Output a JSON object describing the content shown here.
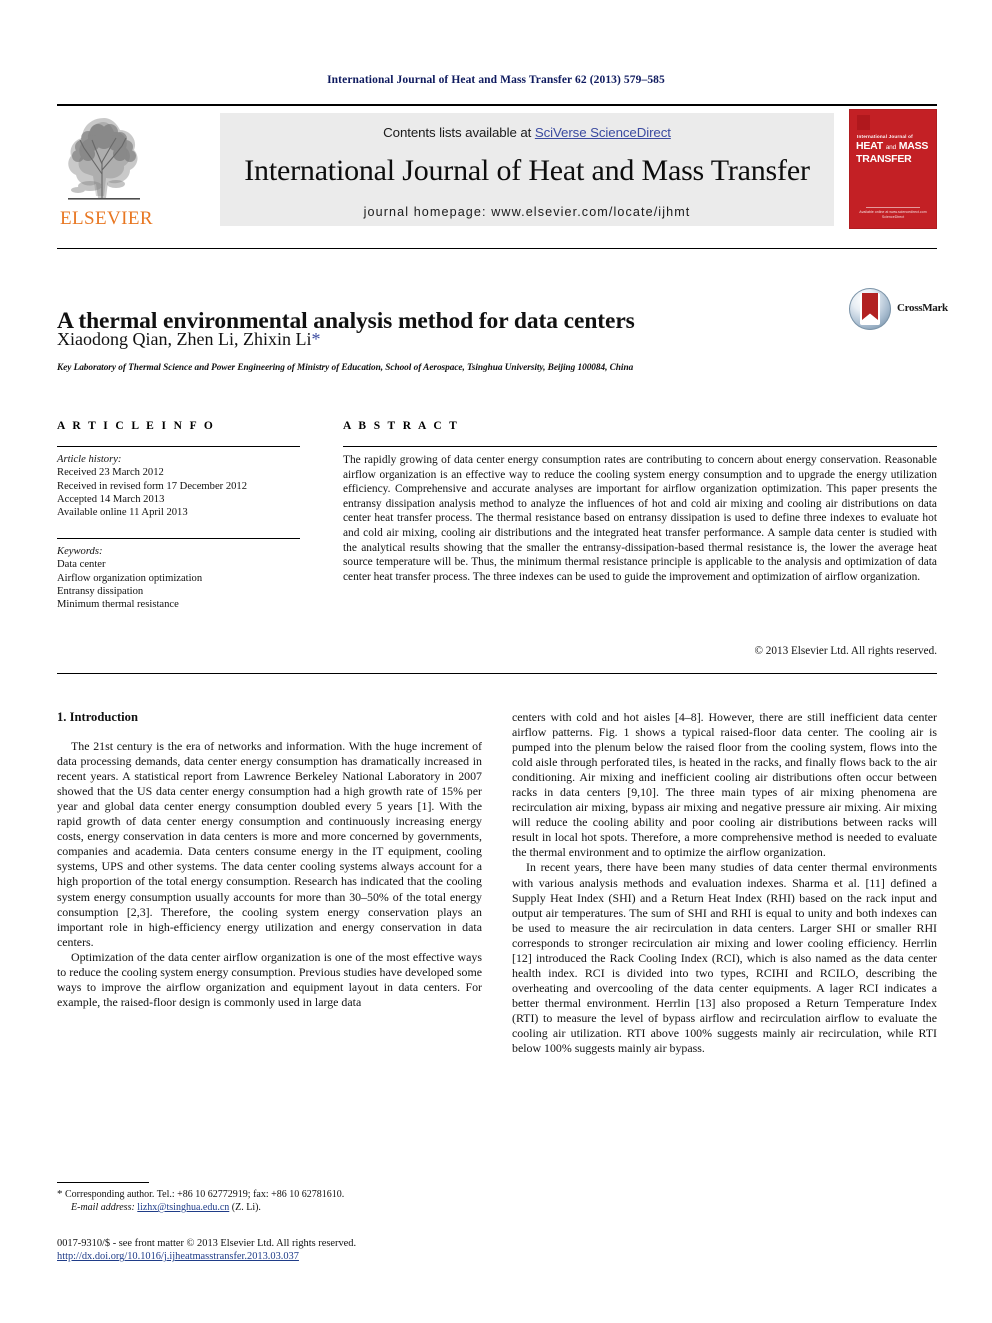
{
  "running_head": "International Journal of Heat and Mass Transfer 62 (2013) 579–585",
  "masthead": {
    "contents_prefix": "Contents lists available at ",
    "sciencedirect_link": "SciVerse ScienceDirect",
    "journal_name": "International Journal of Heat and Mass Transfer",
    "homepage": "journal homepage: www.elsevier.com/locate/ijhmt",
    "publisher": "ELSEVIER",
    "cover": {
      "small_label": "International Journal of",
      "line1": "HEAT",
      "line1_small": "and",
      "line1_b": "MASS",
      "line2": "TRANSFER",
      "footer": "Available online at www.sciencedirect.com",
      "footer2": "ScienceDirect"
    },
    "link_color": "#3b4ba0"
  },
  "article": {
    "title": "A thermal environmental analysis method for data centers",
    "authors": "Xiaodong Qian, Zhen Li, Zhixin Li",
    "author_star": "*",
    "affiliation": "Key Laboratory of Thermal Science and Power Engineering of Ministry of Education, School of Aerospace, Tsinghua University, Beijing 100084, China",
    "crossmark_label": "CrossMark"
  },
  "info": {
    "heading": "A R T I C L E    I N F O",
    "history_label": "Article history:",
    "history": [
      "Received 23 March 2012",
      "Received in revised form 17 December 2012",
      "Accepted 14 March 2013",
      "Available online 11 April 2013"
    ],
    "keywords_label": "Keywords:",
    "keywords": [
      "Data center",
      "Airflow organization optimization",
      "Entransy dissipation",
      "Minimum thermal resistance"
    ]
  },
  "abstract": {
    "heading": "A B S T R A C T",
    "text": "The rapidly growing of data center energy consumption rates are contributing to concern about energy conservation. Reasonable airflow organization is an effective way to reduce the cooling system energy consumption and to upgrade the energy utilization efficiency. Comprehensive and accurate analyses are important for airflow organization optimization. This paper presents the entransy dissipation analysis method to analyze the influences of hot and cold air mixing and cooling air distributions on data center heat transfer process. The thermal resistance based on entransy dissipation is used to define three indexes to evaluate hot and cold air mixing, cooling air distributions and the integrated heat transfer performance. A sample data center is studied with the analytical results showing that the smaller the entransy-dissipation-based thermal resistance is, the lower the average heat source temperature will be. Thus, the minimum thermal resistance principle is applicable to the analysis and optimization of data center heat transfer process. The three indexes can be used to guide the improvement and optimization of airflow organization.",
    "copyright": "© 2013 Elsevier Ltd. All rights reserved."
  },
  "body": {
    "section_heading": "1. Introduction",
    "left_paragraphs": [
      "The 21st century is the era of networks and information. With the huge increment of data processing demands, data center energy consumption has dramatically increased in recent years. A statistical report from Lawrence Berkeley National Laboratory in 2007 showed that the US data center energy consumption had a high growth rate of 15% per year and global data center energy consumption doubled every 5 years [1]. With the rapid growth of data center energy consumption and continuously increasing energy costs, energy conservation in data centers is more and more concerned by governments, companies and academia. Data centers consume energy in the IT equipment, cooling systems, UPS and other systems. The data center cooling systems always account for a high proportion of the total energy consumption. Research has indicated that the cooling system energy consumption usually accounts for more than 30–50% of the total energy consumption [2,3]. Therefore, the cooling system energy conservation plays an important role in high-efficiency energy utilization and energy conservation in data centers.",
      "Optimization of the data center airflow organization is one of the most effective ways to reduce the cooling system energy consumption. Previous studies have developed some ways to improve the airflow organization and equipment layout in data centers. For example, the raised-floor design is commonly used in large data"
    ],
    "right_paragraphs": [
      "centers with cold and hot aisles [4–8]. However, there are still inefficient data center airflow patterns. Fig. 1 shows a typical raised-floor data center. The cooling air is pumped into the plenum below the raised floor from the cooling system, flows into the cold aisle through perforated tiles, is heated in the racks, and finally flows back to the air conditioning. Air mixing and inefficient cooling air distributions often occur between racks in data centers [9,10]. The three main types of air mixing phenomena are recirculation air mixing, bypass air mixing and negative pressure air mixing. Air mixing will reduce the cooling ability and poor cooling air distributions between racks will result in local hot spots. Therefore, a more comprehensive method is needed to evaluate the thermal environment and to optimize the airflow organization.",
      "In recent years, there have been many studies of data center thermal environments with various analysis methods and evaluation indexes. Sharma et al. [11] defined a Supply Heat Index (SHI) and a Return Heat Index (RHI) based on the rack input and output air temperatures. The sum of SHI and RHI is equal to unity and both indexes can be used to measure the air recirculation in data centers. Larger SHI or smaller RHI corresponds to stronger recirculation air mixing and lower cooling efficiency. Herrlin [12] introduced the Rack Cooling Index (RCI), which is also named as the data center health index. RCI is divided into two types, RCIHI and RCILO, describing the overheating and overcooling of the data center equipments. A lager RCI indicates a better thermal environment. Herrlin [13] also proposed a Return Temperature Index (RTI) to measure the level of bypass airflow and recirculation airflow to evaluate the cooling air utilization. RTI above 100% suggests mainly air recirculation, while RTI below 100% suggests mainly air bypass."
    ]
  },
  "footnotes": {
    "corresponding_star": "*",
    "corresponding_text": "Corresponding author. Tel.: +86 10 62772919; fax: +86 10 62781610.",
    "email_label": "E-mail address:",
    "email": "lizhx@tsinghua.edu.cn",
    "email_suffix": " (Z. Li).",
    "issn_line": "0017-9310/$ - see front matter © 2013 Elsevier Ltd. All rights reserved.",
    "doi_line": "http://dx.doi.org/10.1016/j.ijheatmasstransfer.2013.03.037"
  }
}
